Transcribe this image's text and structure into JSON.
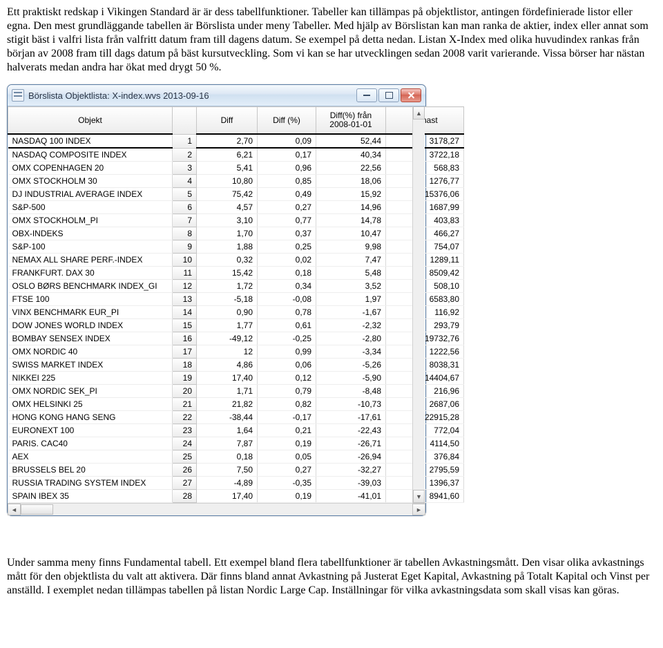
{
  "paragraph1": "Ett praktiskt redskap i Vikingen Standard är är dess tabellfunktioner. Tabeller kan tillämpas på objektlistor, antingen fördefinierade listor eller egna. Den mest grundläggande tabellen är Börslista under meny Tabeller. Med hjälp av Börslistan kan man ranka de aktier, index eller annat som stigit bäst i valfri lista från valfritt datum fram till dagens datum. Se exempel på detta nedan. Listan X-Index med olika huvudindex rankas från början av 2008 fram till dags datum på bäst kursutveckling. Som vi kan se har utvecklingen sedan 2008 varit varierande. Vissa börser har nästan halverats medan andra har ökat med drygt 50 %.",
  "paragraph2": "Under samma meny finns Fundamental tabell. Ett exempel bland flera tabellfunktioner är tabellen Avkastningsmått. Den visar olika avkastnings mått för den objektlista du valt att aktivera. Där finns bland annat Avkastning på Justerat Eget Kapital, Avkastning på Totalt Kapital och Vinst per anställd. I exemplet nedan tillämpas tabellen på listan Nordic Large Cap. Inställningar för vilka avkastningsdata som skall visas kan göras.",
  "window": {
    "title": "Börslista Objektlista: X-index.wvs  2013-09-16"
  },
  "columns": {
    "objekt": "Objekt",
    "diff": "Diff",
    "diffp": "Diff (%)",
    "difff_l1": "Diff(%) från",
    "difff_l2": "2008-01-01",
    "senast": "Senast"
  },
  "rows": [
    {
      "n": "1",
      "name": "NASDAQ 100 INDEX",
      "diff": "2,70",
      "diffp": "0,09",
      "difff": "52,44",
      "senast": "3178,27",
      "hl": true
    },
    {
      "n": "2",
      "name": "NASDAQ COMPOSITE INDEX",
      "diff": "6,21",
      "diffp": "0,17",
      "difff": "40,34",
      "senast": "3722,18"
    },
    {
      "n": "3",
      "name": "OMX COPENHAGEN 20",
      "diff": "5,41",
      "diffp": "0,96",
      "difff": "22,56",
      "senast": "568,83"
    },
    {
      "n": "4",
      "name": "OMX STOCKHOLM 30",
      "diff": "10,80",
      "diffp": "0,85",
      "difff": "18,06",
      "senast": "1276,77"
    },
    {
      "n": "5",
      "name": "DJ INDUSTRIAL AVERAGE INDEX",
      "diff": "75,42",
      "diffp": "0,49",
      "difff": "15,92",
      "senast": "15376,06"
    },
    {
      "n": "6",
      "name": "S&P-500",
      "diff": "4,57",
      "diffp": "0,27",
      "difff": "14,96",
      "senast": "1687,99"
    },
    {
      "n": "7",
      "name": "OMX STOCKHOLM_PI",
      "diff": "3,10",
      "diffp": "0,77",
      "difff": "14,78",
      "senast": "403,83"
    },
    {
      "n": "8",
      "name": "OBX-INDEKS",
      "diff": "1,70",
      "diffp": "0,37",
      "difff": "10,47",
      "senast": "466,27"
    },
    {
      "n": "9",
      "name": "S&P-100",
      "diff": "1,88",
      "diffp": "0,25",
      "difff": "9,98",
      "senast": "754,07"
    },
    {
      "n": "10",
      "name": "NEMAX ALL SHARE PERF.-INDEX",
      "diff": "0,32",
      "diffp": "0,02",
      "difff": "7,47",
      "senast": "1289,11"
    },
    {
      "n": "11",
      "name": "FRANKFURT. DAX 30",
      "diff": "15,42",
      "diffp": "0,18",
      "difff": "5,48",
      "senast": "8509,42"
    },
    {
      "n": "12",
      "name": "OSLO BØRS BENCHMARK INDEX_GI",
      "diff": "1,72",
      "diffp": "0,34",
      "difff": "3,52",
      "senast": "508,10"
    },
    {
      "n": "13",
      "name": "FTSE 100",
      "diff": "-5,18",
      "diffp": "-0,08",
      "difff": "1,97",
      "senast": "6583,80"
    },
    {
      "n": "14",
      "name": "VINX BENCHMARK EUR_PI",
      "diff": "0,90",
      "diffp": "0,78",
      "difff": "-1,67",
      "senast": "116,92"
    },
    {
      "n": "15",
      "name": "DOW JONES WORLD INDEX",
      "diff": "1,77",
      "diffp": "0,61",
      "difff": "-2,32",
      "senast": "293,79"
    },
    {
      "n": "16",
      "name": "BOMBAY SENSEX INDEX",
      "diff": "-49,12",
      "diffp": "-0,25",
      "difff": "-2,80",
      "senast": "19732,76"
    },
    {
      "n": "17",
      "name": "OMX NORDIC 40",
      "diff": "12",
      "diffp": "0,99",
      "difff": "-3,34",
      "senast": "1222,56"
    },
    {
      "n": "18",
      "name": "SWISS MARKET INDEX",
      "diff": "4,86",
      "diffp": "0,06",
      "difff": "-5,26",
      "senast": "8038,31"
    },
    {
      "n": "19",
      "name": "NIKKEI 225",
      "diff": "17,40",
      "diffp": "0,12",
      "difff": "-5,90",
      "senast": "14404,67"
    },
    {
      "n": "20",
      "name": "OMX NORDIC SEK_PI",
      "diff": "1,71",
      "diffp": "0,79",
      "difff": "-8,48",
      "senast": "216,96"
    },
    {
      "n": "21",
      "name": "OMX HELSINKI 25",
      "diff": "21,82",
      "diffp": "0,82",
      "difff": "-10,73",
      "senast": "2687,06"
    },
    {
      "n": "22",
      "name": "HONG KONG HANG SENG",
      "diff": "-38,44",
      "diffp": "-0,17",
      "difff": "-17,61",
      "senast": "22915,28"
    },
    {
      "n": "23",
      "name": "EURONEXT 100",
      "diff": "1,64",
      "diffp": "0,21",
      "difff": "-22,43",
      "senast": "772,04"
    },
    {
      "n": "24",
      "name": "PARIS. CAC40",
      "diff": "7,87",
      "diffp": "0,19",
      "difff": "-26,71",
      "senast": "4114,50"
    },
    {
      "n": "25",
      "name": "AEX",
      "diff": "0,18",
      "diffp": "0,05",
      "difff": "-26,94",
      "senast": "376,84"
    },
    {
      "n": "26",
      "name": "BRUSSELS BEL 20",
      "diff": "7,50",
      "diffp": "0,27",
      "difff": "-32,27",
      "senast": "2795,59"
    },
    {
      "n": "27",
      "name": "RUSSIA TRADING SYSTEM INDEX",
      "diff": "-4,89",
      "diffp": "-0,35",
      "difff": "-39,03",
      "senast": "1396,37"
    },
    {
      "n": "28",
      "name": "SPAIN IBEX 35",
      "diff": "17,40",
      "diffp": "0,19",
      "difff": "-41,01",
      "senast": "8941,60"
    }
  ]
}
